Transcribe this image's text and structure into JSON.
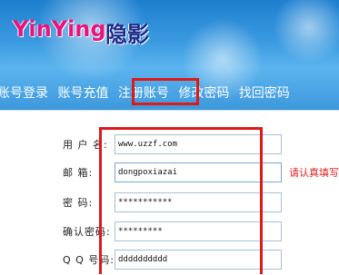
{
  "brand": {
    "name_en": "YinYing",
    "name_cn": "隐影"
  },
  "nav": {
    "items": [
      {
        "label": "账号登录"
      },
      {
        "label": "账号充值"
      },
      {
        "label": "注册账号"
      },
      {
        "label": "修改密码"
      },
      {
        "label": "找回密码"
      }
    ],
    "active_index": 2
  },
  "form": {
    "username": {
      "label": "用 户 名:",
      "value": "www.uzzf.com"
    },
    "email": {
      "label": "邮    箱:",
      "value": "dongpoxiazai",
      "hint": "请认真填写"
    },
    "password": {
      "label": "密    码:",
      "value": "***********"
    },
    "confirm_password": {
      "label": "确认密码:",
      "value": "*********"
    },
    "qq": {
      "label": "Q Q 号码:",
      "value": "dddddddddd"
    }
  },
  "colors": {
    "highlight": "#e01818",
    "hint": "#e02020",
    "header": "#3a9ae0"
  }
}
